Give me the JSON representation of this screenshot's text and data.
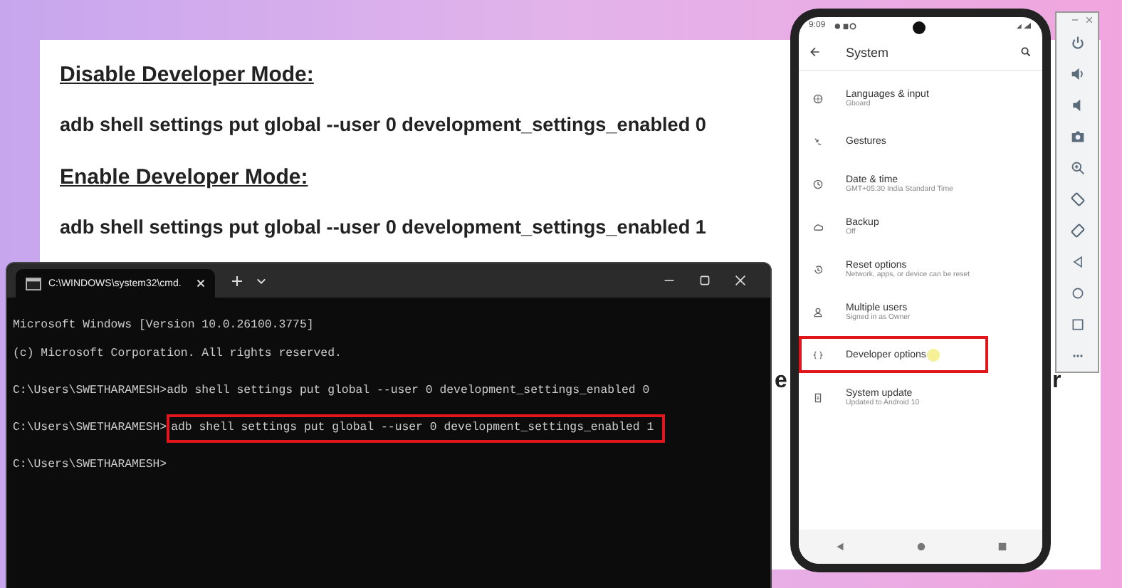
{
  "document": {
    "sections": [
      {
        "heading": "Disable Developer Mode:",
        "command": "adb shell settings put global --user 0 development_settings_enabled 0"
      },
      {
        "heading": "Enable Developer Mode:",
        "command": "adb shell settings put global --user 0 development_settings_enabled 1"
      }
    ],
    "fragments": [
      "e",
      "r"
    ]
  },
  "terminal": {
    "tab_title": "C:\\WINDOWS\\system32\\cmd.",
    "lines": [
      {
        "text": "Microsoft Windows [Version 10.0.26100.3775]"
      },
      {
        "text": "(c) Microsoft Corporation. All rights reserved."
      },
      {
        "prompt": "C:\\Users\\SWETHARAMESH>",
        "command": "adb shell settings put global --user 0 development_settings_enabled 0",
        "highlighted": false
      },
      {
        "prompt": "C:\\Users\\SWETHARAMESH>",
        "command": "adb shell settings put global --user 0 development_settings_enabled 1",
        "highlighted": true
      },
      {
        "prompt": "C:\\Users\\SWETHARAMESH>"
      }
    ]
  },
  "phone": {
    "time": "9:09",
    "title": "System",
    "items": [
      {
        "title": "Languages & input",
        "subtitle": "Gboard",
        "highlighted": false
      },
      {
        "title": "Gestures",
        "highlighted": false
      },
      {
        "title": "Date & time",
        "subtitle": "GMT+05:30 India Standard Time",
        "highlighted": false
      },
      {
        "title": "Backup",
        "subtitle": "Off",
        "highlighted": false
      },
      {
        "title": "Reset options",
        "subtitle": "Network, apps, or device can be reset",
        "highlighted": false
      },
      {
        "title": "Multiple users",
        "subtitle": "Signed in as Owner",
        "highlighted": false
      },
      {
        "title": "Developer options",
        "highlighted": true
      },
      {
        "title": "System update",
        "subtitle": "Updated to Android 10",
        "highlighted": false
      }
    ]
  }
}
